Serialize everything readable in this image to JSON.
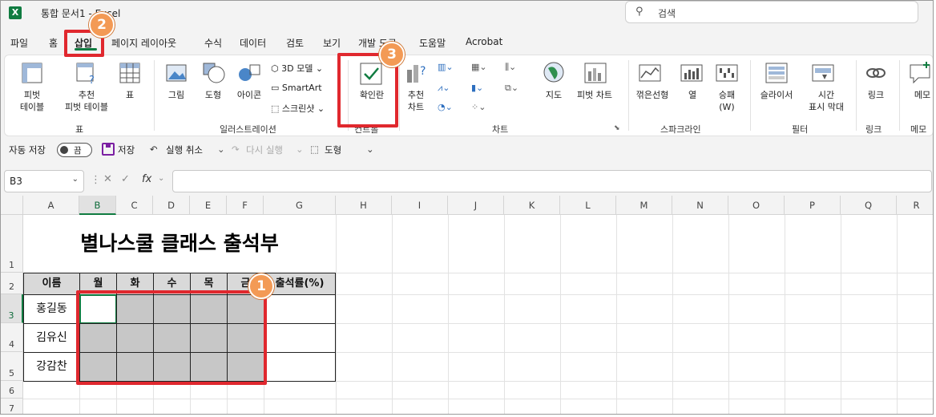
{
  "app": {
    "title": "통합 문서1 - Excel",
    "search_placeholder": "검색",
    "logo_letter": "X"
  },
  "menu": [
    "파일",
    "홈",
    "삽입",
    "페이지 레이아웃",
    "수식",
    "데이터",
    "검토",
    "보기",
    "개발 도구",
    "도움말",
    "Acrobat"
  ],
  "ribbon": {
    "pivot_table": "피벗\n테이블",
    "recommended_pivot": "추천\n피벗 테이블",
    "table": "표",
    "picture": "그림",
    "shapes": "도형",
    "icons": "아이콘",
    "models3d": "3D 모델",
    "smartart": "SmartArt",
    "screenshot": "스크린샷",
    "checkbox": "확인란",
    "recommended_charts": "추천\n차트",
    "maps": "지도",
    "pivot_chart": "피벗 차트",
    "sparkline_line": "꺾은선형",
    "sparkline_column": "열",
    "sparkline_winloss": "승패\n(W)",
    "slicer": "슬라이서",
    "timeline": "시간\n표시 막대",
    "link": "링크",
    "memo": "메모",
    "groups": {
      "tables": "표",
      "illustrations": "일러스트레이션",
      "controls": "컨트롤",
      "charts": "차트",
      "sparklines": "스파크라인",
      "filters": "필터",
      "links": "링크",
      "memos": "메모"
    }
  },
  "qat": {
    "autosave": "자동 저장",
    "toggle_state": "끔",
    "save": "저장",
    "undo": "실행 취소",
    "redo": "다시 실행",
    "shapes": "도형"
  },
  "formula_bar": {
    "name_box": "B3",
    "fx": "fx",
    "value": ""
  },
  "sheet": {
    "columns": [
      "A",
      "B",
      "C",
      "D",
      "E",
      "F",
      "G",
      "H",
      "I",
      "J",
      "K",
      "L",
      "M",
      "N",
      "O",
      "P",
      "Q",
      "R"
    ],
    "rows": [
      "1",
      "2",
      "3",
      "4",
      "5",
      "6",
      "7"
    ],
    "title": "별나스쿨 클래스 출석부",
    "headers": [
      "이름",
      "월",
      "화",
      "수",
      "목",
      "금",
      "출석률(%)"
    ],
    "students": [
      "홍길동",
      "김유신",
      "강감찬"
    ]
  },
  "annotations": {
    "step1": "1",
    "step2": "2",
    "step3": "3",
    "color": "#e0282e",
    "badge_color": "#f39a55"
  }
}
